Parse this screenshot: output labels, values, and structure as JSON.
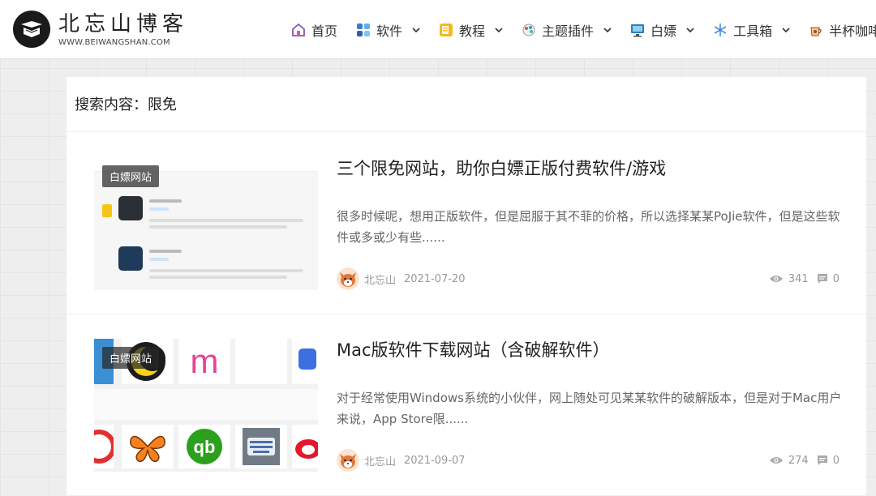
{
  "header": {
    "logo_title": "北忘山博客",
    "logo_url_text": "WWW.BEIWANGSHAN.COM",
    "nav": [
      {
        "label": "首页",
        "icon": "home-icon",
        "has_dropdown": false
      },
      {
        "label": "软件",
        "icon": "apps-icon",
        "has_dropdown": true
      },
      {
        "label": "教程",
        "icon": "book-icon",
        "has_dropdown": true
      },
      {
        "label": "主题插件",
        "icon": "palette-icon",
        "has_dropdown": true
      },
      {
        "label": "白嫖",
        "icon": "monitor-icon",
        "has_dropdown": true
      },
      {
        "label": "工具箱",
        "icon": "snowflake-icon",
        "has_dropdown": true
      },
      {
        "label": "半杯咖啡",
        "icon": "coffee-icon",
        "has_dropdown": false
      }
    ]
  },
  "search": {
    "title": "搜索内容：限免"
  },
  "posts": [
    {
      "tag": "白嫖网站",
      "title": "三个限免网站，助你白嫖正版付费软件/游戏",
      "excerpt": "很多时候呢，想用正版软件，但是屈服于其不菲的价格，所以选择某某PoJie软件，但是这些软件或多或少有些......",
      "author": "北忘山",
      "date": "2021-07-20",
      "views": "341",
      "comments": "0"
    },
    {
      "tag": "白嫖网站",
      "title": "Mac版软件下载网站（含破解软件）",
      "excerpt": "对于经常使用Windows系统的小伙伴，网上随处可见某某软件的破解版本，但是对于Mac用户来说，App Store限......",
      "author": "北忘山",
      "date": "2021-09-07",
      "views": "274",
      "comments": "0"
    }
  ],
  "colors": {
    "accent": "#f39c12",
    "text": "#222222",
    "muted": "#999999"
  }
}
